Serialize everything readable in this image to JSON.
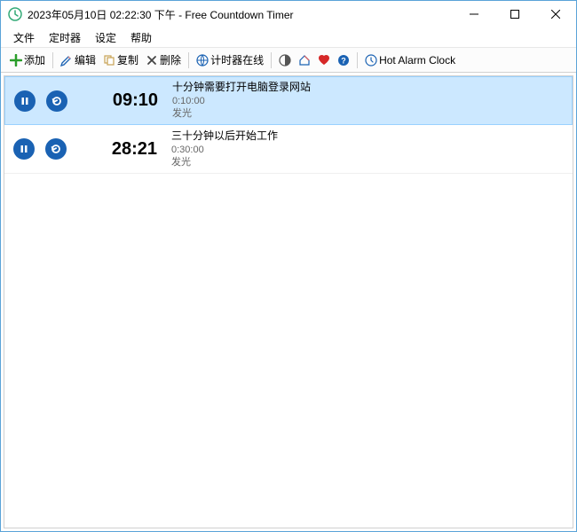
{
  "window": {
    "title": "2023年05月10日 02:22:30 下午 - Free Countdown Timer"
  },
  "menu": {
    "file": "文件",
    "timer": "定时器",
    "settings": "设定",
    "help": "帮助"
  },
  "toolbar": {
    "add": "添加",
    "edit": "编辑",
    "copy": "复制",
    "delete": "删除",
    "online": "计时器在线",
    "hot": "Hot Alarm Clock"
  },
  "timers": [
    {
      "countdown": "09:10",
      "desc": "十分钟需要打开电脑登录网站",
      "duration": "0:10:00",
      "action": "发光"
    },
    {
      "countdown": "28:21",
      "desc": "三十分钟以后开始工作",
      "duration": "0:30:00",
      "action": "发光"
    }
  ]
}
